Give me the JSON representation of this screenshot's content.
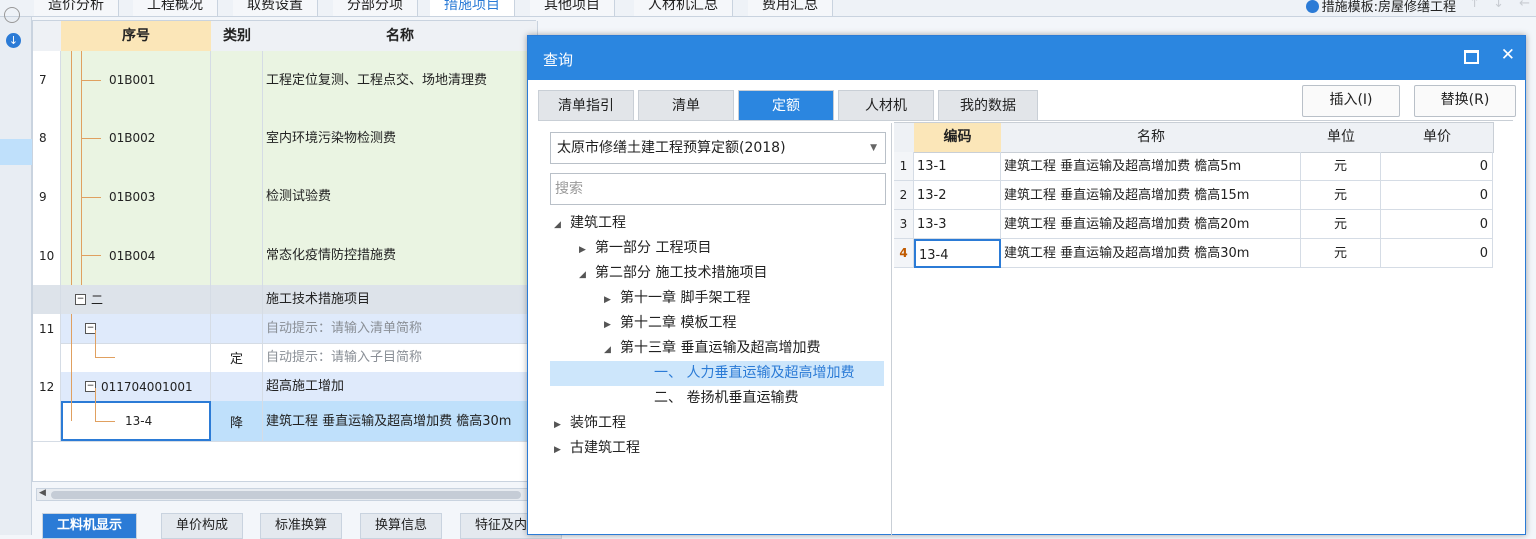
{
  "top_tabs": [
    "造价分析",
    "工程概况",
    "取费设置",
    "分部分项",
    "措施项目",
    "其他项目",
    "人材机汇总",
    "费用汇总"
  ],
  "active_top_tab": 4,
  "template_label": "措施模板:房屋修缮工程",
  "main_grid": {
    "headers": {
      "seq": "序号",
      "type": "类别",
      "name": "名称"
    },
    "rows": [
      {
        "idx": "7",
        "seq": "01B001",
        "type": "",
        "name": "工程定位复测、工程点交、场地清理费"
      },
      {
        "idx": "8",
        "seq": "01B002",
        "type": "",
        "name": "室内环境污染物检测费"
      },
      {
        "idx": "9",
        "seq": "01B003",
        "type": "",
        "name": "检测试验费"
      },
      {
        "idx": "10",
        "seq": "01B004",
        "type": "",
        "name": "常态化疫情防控措施费"
      },
      {
        "idx": "",
        "seq": "二",
        "type": "",
        "name": "施工技术措施项目"
      },
      {
        "idx": "11",
        "seq": "",
        "type": "",
        "name": "自动提示：请输入清单简称"
      },
      {
        "idx": "",
        "seq": "",
        "type": "定",
        "name": "自动提示：请输入子目简称"
      },
      {
        "idx": "12",
        "seq": "011704001001",
        "type": "",
        "name": "超高施工增加"
      },
      {
        "idx": "",
        "seq": "13-4",
        "type": "降",
        "name": "建筑工程 垂直运输及超高增加费 檐高30m"
      }
    ]
  },
  "bottom_tabs": [
    "工料机显示",
    "单价构成",
    "标准换算",
    "换算信息",
    "特征及内"
  ],
  "dialog": {
    "title": "查询",
    "tabs": [
      "清单指引",
      "清单",
      "定额",
      "人材机",
      "我的数据"
    ],
    "active_tab": 2,
    "insert_button": "插入(I)",
    "replace_button": "替换(R)",
    "library": "太原市修缮土建工程预算定额(2018)",
    "search_placeholder": "搜索",
    "tree": [
      {
        "label": "建筑工程",
        "level": 0,
        "state": "open"
      },
      {
        "label": "第一部分 工程项目",
        "level": 1,
        "state": "closed"
      },
      {
        "label": "第二部分 施工技术措施项目",
        "level": 1,
        "state": "open"
      },
      {
        "label": "第十一章 脚手架工程",
        "level": 2,
        "state": "closed"
      },
      {
        "label": "第十二章 模板工程",
        "level": 2,
        "state": "closed"
      },
      {
        "label": "第十三章 垂直运输及超高增加费",
        "level": 2,
        "state": "open"
      },
      {
        "label": "一、 人力垂直运输及超高增加费",
        "level": 3,
        "state": "leaf",
        "selected": true
      },
      {
        "label": "二、 卷扬机垂直运输费",
        "level": 3,
        "state": "leaf"
      },
      {
        "label": "装饰工程",
        "level": 0,
        "state": "closed"
      },
      {
        "label": "古建筑工程",
        "level": 0,
        "state": "closed"
      }
    ],
    "table": {
      "headers": {
        "code": "编码",
        "name": "名称",
        "unit": "单位",
        "price": "单价"
      },
      "rows": [
        {
          "num": "1",
          "code": "13-1",
          "name": "建筑工程 垂直运输及超高增加费 檐高5m",
          "unit": "元",
          "price": "0"
        },
        {
          "num": "2",
          "code": "13-2",
          "name": "建筑工程 垂直运输及超高增加费 檐高15m",
          "unit": "元",
          "price": "0"
        },
        {
          "num": "3",
          "code": "13-3",
          "name": "建筑工程 垂直运输及超高增加费 檐高20m",
          "unit": "元",
          "price": "0"
        },
        {
          "num": "4",
          "code": "13-4",
          "name": "建筑工程 垂直运输及超高增加费 檐高30m",
          "unit": "元",
          "price": "0"
        }
      ],
      "current_row": 3
    }
  },
  "colors": {
    "accent": "#2b86e0",
    "header_highlight": "#fbe6b8",
    "selection": "#bfe0fb",
    "measure_row": "#eaf4e2"
  }
}
